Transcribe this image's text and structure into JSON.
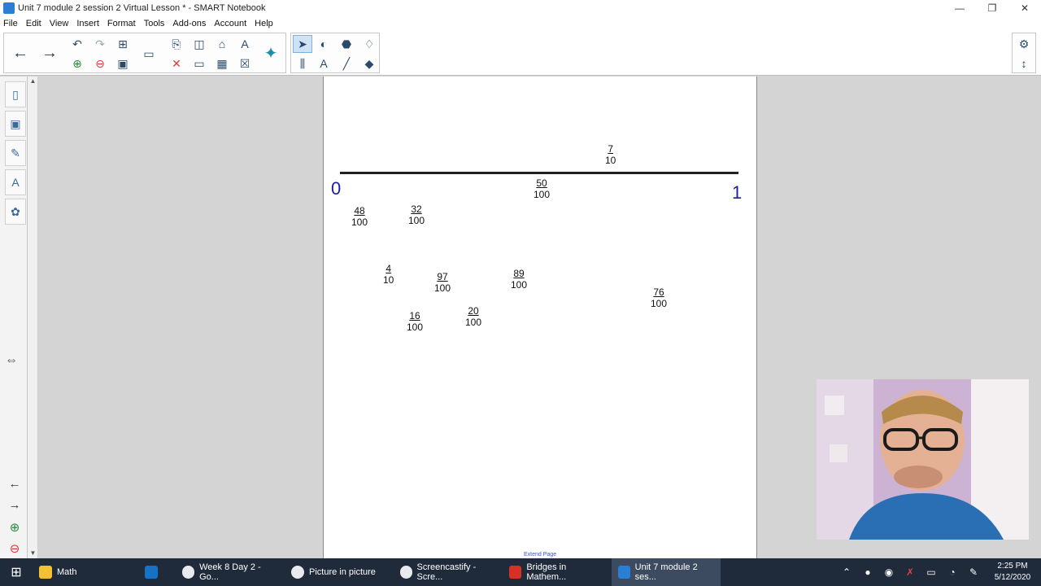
{
  "window": {
    "title": "Unit 7 module 2 session 2 Virtual Lesson * - SMART Notebook",
    "minimize": "—",
    "restore": "❐",
    "close": "✕"
  },
  "menu": [
    "File",
    "Edit",
    "View",
    "Insert",
    "Format",
    "Tools",
    "Add-ons",
    "Account",
    "Help"
  ],
  "toolbar": {
    "back": "←",
    "forward": "→"
  },
  "canvas": {
    "start_label": "0",
    "end_label": "1",
    "extend_link": "Extend Page",
    "fractions": [
      {
        "num": "7",
        "den": "10"
      },
      {
        "num": "50",
        "den": "100"
      },
      {
        "num": "48",
        "den": "100"
      },
      {
        "num": "32",
        "den": "100"
      },
      {
        "num": "4",
        "den": "10"
      },
      {
        "num": "97",
        "den": "100"
      },
      {
        "num": "89",
        "den": "100"
      },
      {
        "num": "76",
        "den": "100"
      },
      {
        "num": "16",
        "den": "100"
      },
      {
        "num": "20",
        "den": "100"
      }
    ]
  },
  "taskbar": {
    "items": [
      {
        "label": "Math",
        "color": "#f2c230"
      },
      {
        "label": "",
        "color": "#1572c5"
      },
      {
        "label": "Week 8 Day 2 - Go...",
        "color": "#e8eaed"
      },
      {
        "label": "Picture in picture",
        "color": "#e8eaed"
      },
      {
        "label": "Screencastify - Scre...",
        "color": "#e8eaed"
      },
      {
        "label": "Bridges in Mathem...",
        "color": "#d93025"
      },
      {
        "label": "Unit 7 module 2 ses...",
        "color": "#2a7fd4"
      }
    ],
    "time": "2:25 PM",
    "date": "5/12/2020"
  }
}
